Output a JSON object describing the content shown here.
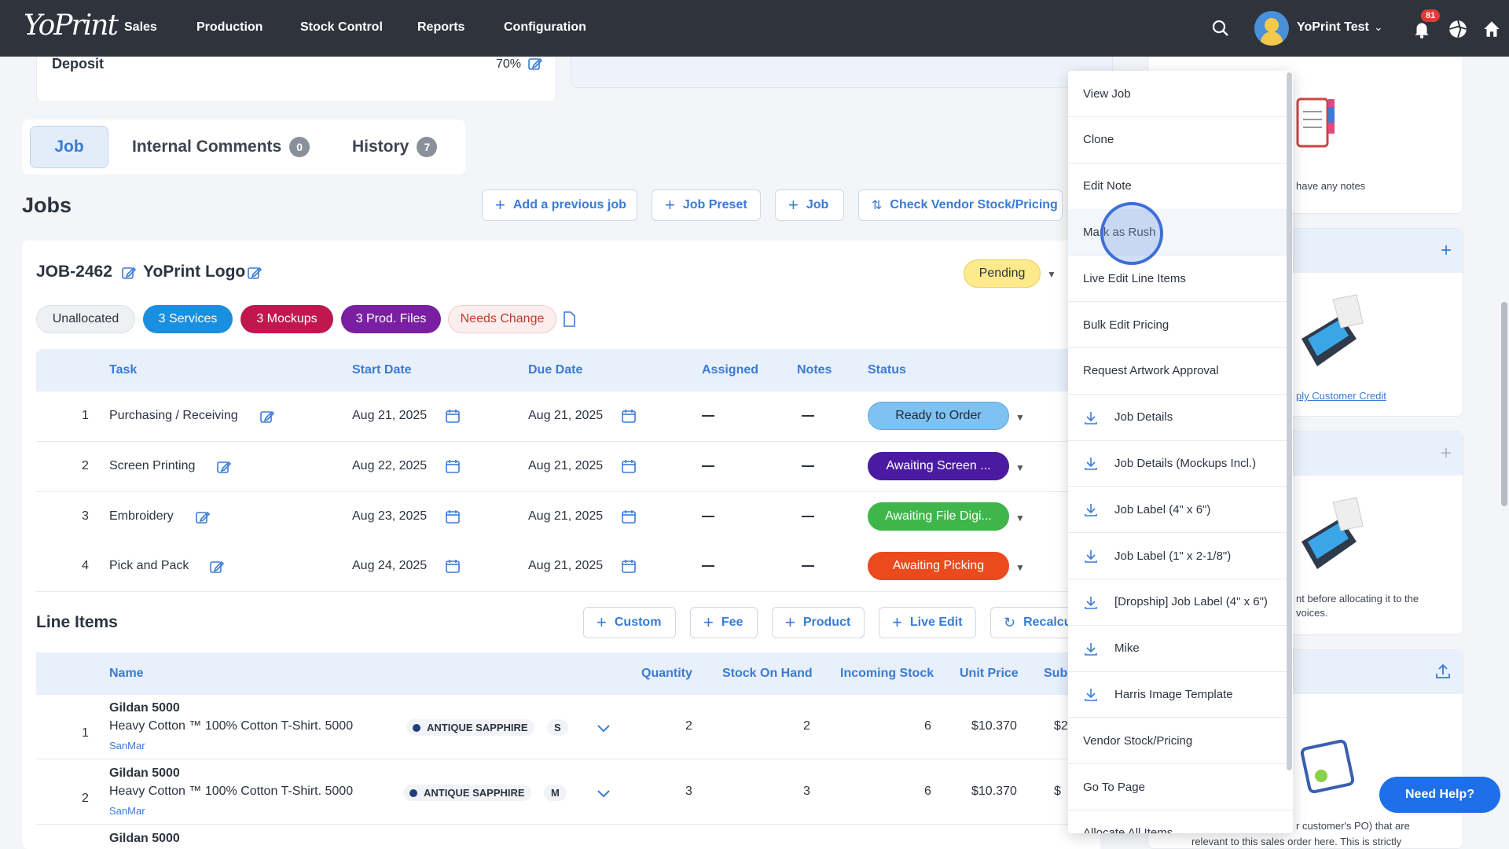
{
  "nav": {
    "logo": "YoPrint",
    "items": [
      "Sales",
      "Production",
      "Stock Control",
      "Reports",
      "Configuration"
    ],
    "user_name": "YoPrint Test",
    "notification_count": "81",
    "icons": [
      "search-icon",
      "bell-icon",
      "aperture-icon",
      "home-icon"
    ]
  },
  "deposit": {
    "label": "Deposit",
    "value": "70%"
  },
  "tabs": [
    {
      "label": "Job",
      "count": ""
    },
    {
      "label": "Internal Comments",
      "count": "0"
    },
    {
      "label": "History",
      "count": "7"
    }
  ],
  "jobs": {
    "heading": "Jobs",
    "buttons": [
      "Add a previous job",
      "Job Preset",
      "Job",
      "Check Vendor Stock/Pricing"
    ]
  },
  "job": {
    "id": "JOB-2462",
    "name": "YoPrint Logo",
    "status": "Pending",
    "pills": [
      "Unallocated",
      "3 Services",
      "3 Mockups",
      "3 Prod. Files",
      "Needs Change"
    ]
  },
  "tasks": {
    "headers": [
      "Task",
      "Start Date",
      "Due Date",
      "Assigned",
      "Notes",
      "Status"
    ],
    "rows": [
      {
        "num": "1",
        "task": "Purchasing / Receiving",
        "start": "Aug 21, 2025",
        "due": "Aug 21, 2025",
        "status": "Ready to Order",
        "status_color": "#7ec2f2"
      },
      {
        "num": "2",
        "task": "Screen Printing",
        "start": "Aug 22, 2025",
        "due": "Aug 21, 2025",
        "status": "Awaiting Screen ...",
        "status_color": "#4a1aa0"
      },
      {
        "num": "3",
        "task": "Embroidery",
        "start": "Aug 23, 2025",
        "due": "Aug 21, 2025",
        "status": "Awaiting File Digi...",
        "status_color": "#3fb64a"
      },
      {
        "num": "4",
        "task": "Pick and Pack",
        "start": "Aug 24, 2025",
        "due": "Aug 21, 2025",
        "status": "Awaiting Picking",
        "status_color": "#ea4a1c"
      }
    ]
  },
  "line_items": {
    "heading": "Line Items",
    "buttons": [
      "Custom",
      "Fee",
      "Product",
      "Live Edit",
      "Recalcu"
    ],
    "headers": [
      "Name",
      "Quantity",
      "Stock On Hand",
      "Incoming Stock",
      "Unit Price",
      "Sub"
    ],
    "rows": [
      {
        "num": "1",
        "product": "Gildan 5000",
        "desc": "Heavy Cotton ™ 100% Cotton T-Shirt. 5000",
        "vendor": "SanMar",
        "color": "ANTIQUE SAPPHIRE",
        "size": "S",
        "qty": "2",
        "stock": "2",
        "incoming": "6",
        "price": "$10.370",
        "sub": "$2"
      },
      {
        "num": "2",
        "product": "Gildan 5000",
        "desc": "Heavy Cotton ™ 100% Cotton T-Shirt. 5000",
        "vendor": "SanMar",
        "color": "ANTIQUE SAPPHIRE",
        "size": "M",
        "qty": "3",
        "stock": "3",
        "incoming": "6",
        "price": "$10.370",
        "sub": "$"
      },
      {
        "num": "",
        "product": "Gildan 5000"
      }
    ]
  },
  "menu": {
    "items": [
      {
        "label": "View Job",
        "download": false
      },
      {
        "label": "Clone",
        "download": false
      },
      {
        "label": "Edit Note",
        "download": false
      },
      {
        "label": "Mark as Rush",
        "download": false
      },
      {
        "label": "Live Edit Line Items",
        "download": false
      },
      {
        "label": "Bulk Edit Pricing",
        "download": false
      },
      {
        "label": "Request Artwork Approval",
        "download": false
      },
      {
        "label": "Job Details",
        "download": true
      },
      {
        "label": "Job Details (Mockups Incl.)",
        "download": true
      },
      {
        "label": "Job Label (4\" x 6\")",
        "download": true
      },
      {
        "label": "Job Label (1\" x 2-1/8\")",
        "download": true
      },
      {
        "label": "[Dropship] Job Label (4\" x 6\")",
        "download": true
      },
      {
        "label": "Mike",
        "download": true
      },
      {
        "label": "Harris Image Template",
        "download": true
      },
      {
        "label": "Vendor Stock/Pricing",
        "download": false
      },
      {
        "label": "Go To Page",
        "download": false
      },
      {
        "label": "Allocate All Items",
        "download": false
      }
    ]
  },
  "right": {
    "notes_text": "have any notes",
    "credit_link": "ply Customer Credit",
    "alloc_text_1": "nt before allocating it to the",
    "alloc_text_2": "voices.",
    "po_text_1": "r customer's PO) that are",
    "po_text_2": "relevant to this sales order here. This is strictly"
  },
  "help": {
    "label": "Need Help?"
  }
}
